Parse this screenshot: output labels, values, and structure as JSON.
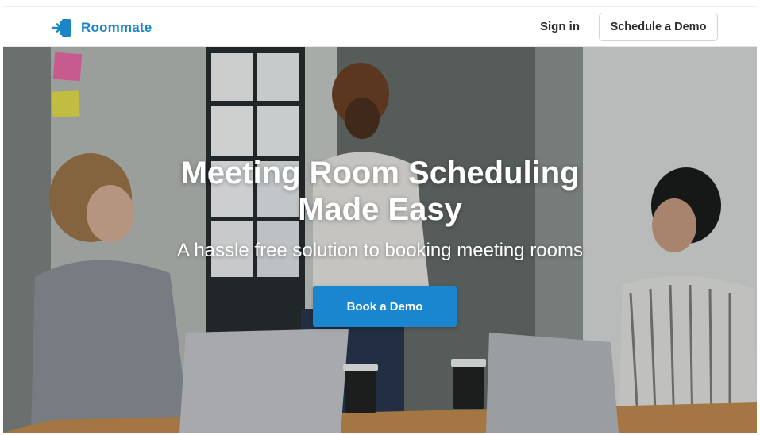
{
  "nav": {
    "brand_name": "Roommate",
    "brand_icon": "door-enter-icon",
    "sign_in_label": "Sign in",
    "schedule_demo_label": "Schedule a Demo"
  },
  "hero": {
    "title_line1": "Meeting Room Scheduling",
    "title_line2": "Made Easy",
    "subtitle": "A hassle free solution to booking meeting rooms",
    "cta_label": "Book a Demo"
  },
  "colors": {
    "brand": "#1a86c7",
    "cta": "#1a86d0",
    "nav_text": "#2b2b2b"
  }
}
